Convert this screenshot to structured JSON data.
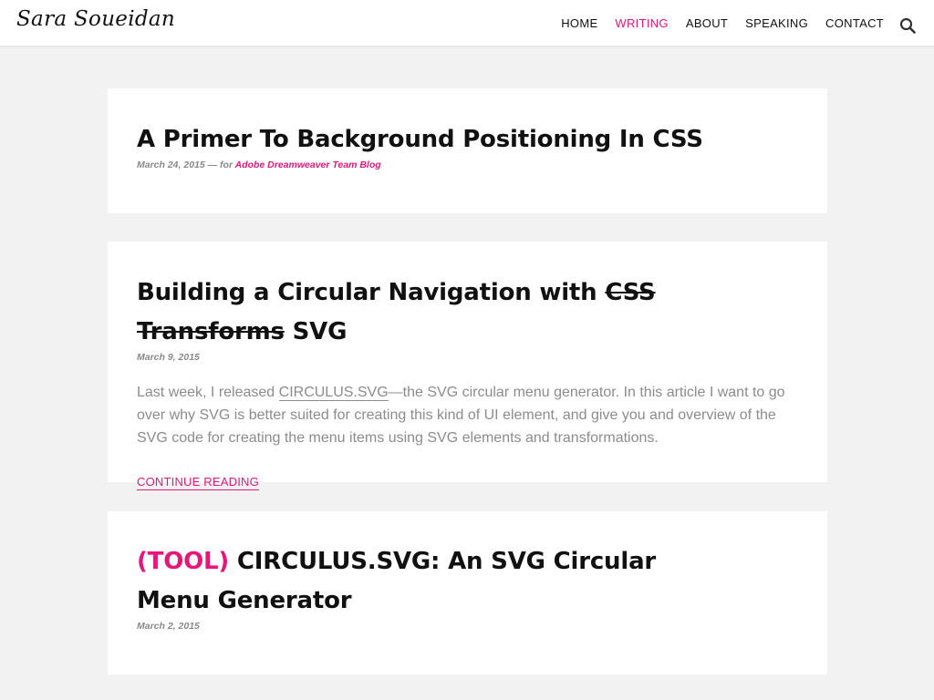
{
  "site": {
    "logo": "Sara Soueidan"
  },
  "nav": {
    "items": [
      {
        "label": "HOME"
      },
      {
        "label": "WRITING"
      },
      {
        "label": "ABOUT"
      },
      {
        "label": "SPEAKING"
      },
      {
        "label": "CONTACT"
      }
    ],
    "active": "WRITING",
    "search_icon": "search-icon"
  },
  "colors": {
    "accent": "#e6177a",
    "background": "#f2f2f2",
    "card": "#ffffff",
    "muted_text": "#8c8c8c"
  },
  "posts": [
    {
      "title": "A Primer To Background Positioning In CSS",
      "date": "March 24, 2015",
      "meta_separator": " — for ",
      "source": "Adobe Dreamweaver Team Blog"
    },
    {
      "title_part1": "Building a Circular Navigation with ",
      "title_strike": "CSS Transforms",
      "title_part2": " SVG",
      "date": "March 9, 2015",
      "excerpt_before": "Last week, I released ",
      "excerpt_link": "CIRCULUS.SVG",
      "excerpt_after": "—the SVG circular menu generator. In this article I want to go over why SVG is better suited for creating this kind of UI element, and give you and overview of the SVG code for creating the menu items using SVG elements and transformations.",
      "continue_label": "CONTINUE READING"
    },
    {
      "tag": "(TOOL)",
      "title": " CIRCULUS.SVG: An SVG Circular Menu Generator",
      "date": "March 2, 2015"
    }
  ]
}
